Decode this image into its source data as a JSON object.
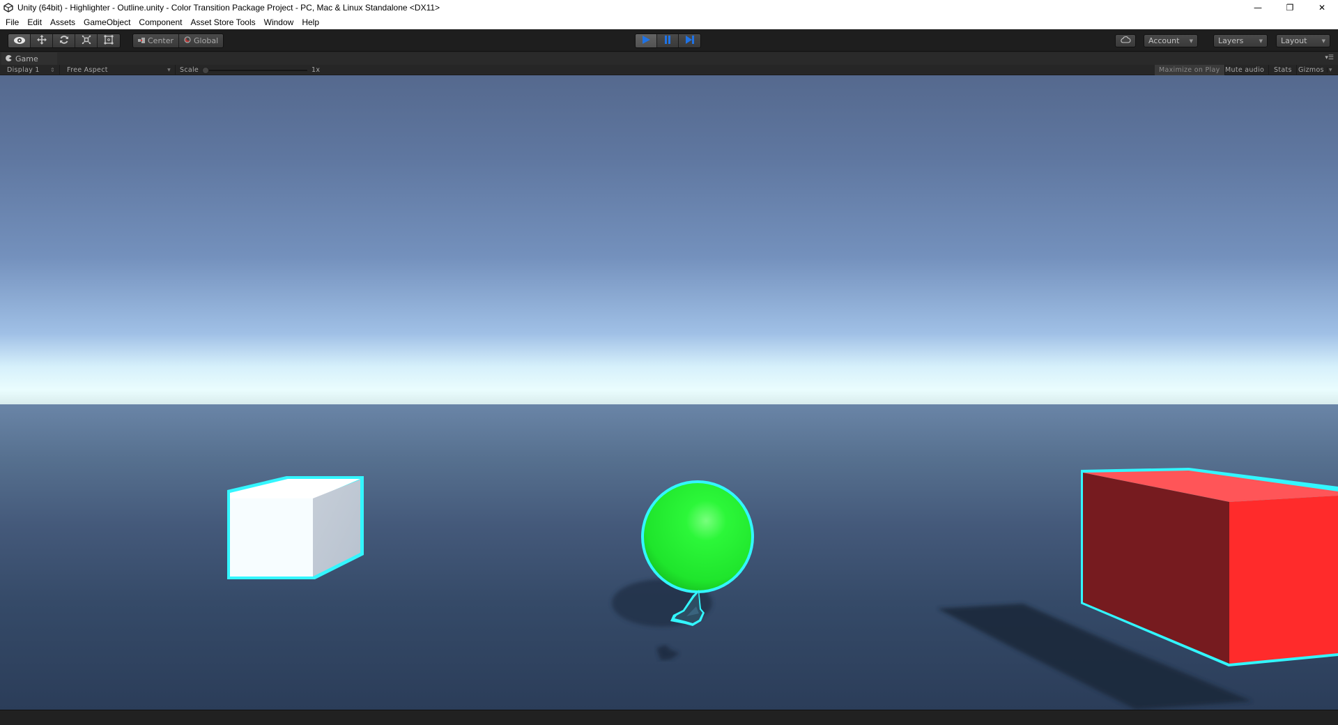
{
  "window": {
    "title": "Unity (64bit) - Highlighter - Outline.unity - Color Transition Package Project - PC, Mac & Linux Standalone <DX11>",
    "app_icon": "unity-logo-icon",
    "controls": {
      "minimize": "—",
      "restore": "❐",
      "close": "✕"
    }
  },
  "menu": {
    "items": [
      "File",
      "Edit",
      "Assets",
      "GameObject",
      "Component",
      "Asset Store Tools",
      "Window",
      "Help"
    ]
  },
  "toolbar": {
    "tools": [
      {
        "name": "view-tool",
        "icon": "eye-icon",
        "active": true
      },
      {
        "name": "move-tool",
        "icon": "move-arrows-icon",
        "active": false
      },
      {
        "name": "rotate-tool",
        "icon": "rotate-icon",
        "active": false
      },
      {
        "name": "scale-tool",
        "icon": "scale-icon",
        "active": false
      },
      {
        "name": "rect-tool",
        "icon": "rect-transform-icon",
        "active": false
      }
    ],
    "pivot_mode": "Center",
    "pivot_rotation": "Global",
    "play": {
      "playing": true,
      "paused": false
    },
    "cloud_icon": "cloud-icon",
    "account_label": "Account",
    "layers_label": "Layers",
    "layout_label": "Layout"
  },
  "game_tab": {
    "label": "Game",
    "icon": "pacman-game-icon"
  },
  "game_bar": {
    "display": "Display 1",
    "aspect": "Free Aspect",
    "scale_label": "Scale",
    "scale_value": "1x",
    "scale_fraction": 0.0,
    "maximize_on_play": "Maximize on Play",
    "maximize_on_play_enabled": true,
    "mute_audio": "Mute audio",
    "stats": "Stats",
    "gizmos": "Gizmos"
  },
  "scene": {
    "outline_color": "#33f6ff",
    "objects": [
      {
        "name": "white-cube",
        "color": "#f7fdff",
        "side_color": "#c0c8d2",
        "highlighted": true
      },
      {
        "name": "green-sphere",
        "color": "#22f032",
        "highlighted": true
      },
      {
        "name": "butterfly",
        "color": "#2d4e63",
        "highlighted": true
      },
      {
        "name": "red-box",
        "color": "#ff2b2b",
        "front_color": "#761b1f",
        "top_color": "#ff5558",
        "highlighted": true
      }
    ]
  }
}
